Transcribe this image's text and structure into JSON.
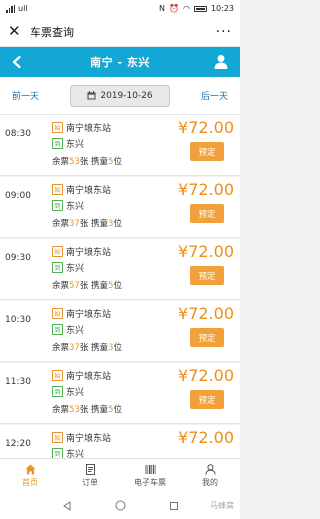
{
  "status_bar": {
    "signal": "ull",
    "time": "10:23"
  },
  "wechat_bar": {
    "close": "✕",
    "title": "车票查询",
    "more": "···"
  },
  "header": {
    "title": "南宁 - 东兴"
  },
  "date_nav": {
    "prev": "前一天",
    "date": "2019-10-26",
    "next": "后一天"
  },
  "tickets": [
    {
      "time": "08:30",
      "from": "南宁埌东站",
      "to": "东兴",
      "from_tag": "始",
      "to_tag": "到",
      "remaining": "53",
      "child": "5",
      "price": "¥72.00",
      "button": "预定"
    },
    {
      "time": "09:00",
      "from": "南宁埌东站",
      "to": "东兴",
      "from_tag": "始",
      "to_tag": "到",
      "remaining": "37",
      "child": "3",
      "price": "¥72.00",
      "button": "预定"
    },
    {
      "time": "09:30",
      "from": "南宁埌东站",
      "to": "东兴",
      "from_tag": "始",
      "to_tag": "到",
      "remaining": "57",
      "child": "5",
      "price": "¥72.00",
      "button": "预定"
    },
    {
      "time": "10:30",
      "from": "南宁埌东站",
      "to": "东兴",
      "from_tag": "始",
      "to_tag": "到",
      "remaining": "37",
      "child": "3",
      "price": "¥72.00",
      "button": "预定"
    },
    {
      "time": "11:30",
      "from": "南宁埌东站",
      "to": "东兴",
      "from_tag": "始",
      "to_tag": "到",
      "remaining": "53",
      "child": "5",
      "price": "¥72.00",
      "button": "预定"
    },
    {
      "time": "12:20",
      "from": "南宁埌东站",
      "to": "东兴",
      "from_tag": "始",
      "to_tag": "到",
      "remaining": "",
      "child": "",
      "price": "¥72.00",
      "button": ""
    }
  ],
  "labels": {
    "remaining_prefix": "余票",
    "remaining_suffix": "张 携童",
    "child_suffix": "位"
  },
  "tabs": [
    {
      "label": "首页",
      "icon": "home-icon",
      "active": true
    },
    {
      "label": "订单",
      "icon": "order-icon",
      "active": false
    },
    {
      "label": "电子车票",
      "icon": "ticket-icon",
      "active": false
    },
    {
      "label": "我的",
      "icon": "user-icon",
      "active": false
    }
  ],
  "watermark": "马蜂窝",
  "colors": {
    "accent_blue": "#13a7d6",
    "price_orange": "#ef8f1b",
    "button_orange": "#f2a03a",
    "tag_green": "#4caf50"
  }
}
